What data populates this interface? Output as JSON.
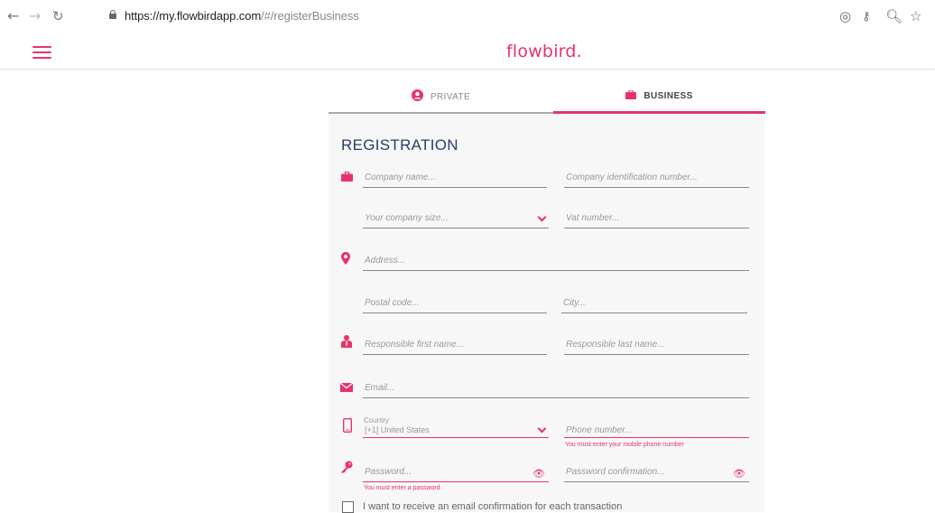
{
  "browser": {
    "url_host": "https://my.flowbirdapp.com",
    "url_path": "/#/registerBusiness"
  },
  "app": {
    "logo": "flowbird",
    "logo_dot": "."
  },
  "tabs": [
    {
      "label": "PRIVATE"
    },
    {
      "label": "BUSINESS"
    }
  ],
  "form": {
    "title": "REGISTRATION",
    "company_name": "Company name...",
    "company_id": "Company identification number...",
    "company_size": "Your company size...",
    "vat_number": "Vat number...",
    "address": "Address...",
    "postal_code": "Postal code...",
    "city": "City...",
    "first_name": "Responsible first name...",
    "last_name": "Responsible last name...",
    "email": "Email...",
    "country_label": "Country",
    "country_value": "[+1] United States",
    "phone": "Phone number...",
    "phone_error": "You must enter your mobile phone number",
    "password": "Password...",
    "password_error": "You must enter a password",
    "password_confirm": "Password confirmation...",
    "email_confirm_checkbox": "I want to receive an email confirmation for each transaction"
  },
  "colors": {
    "accent": "#e8336a",
    "title": "#2b3a6b"
  }
}
